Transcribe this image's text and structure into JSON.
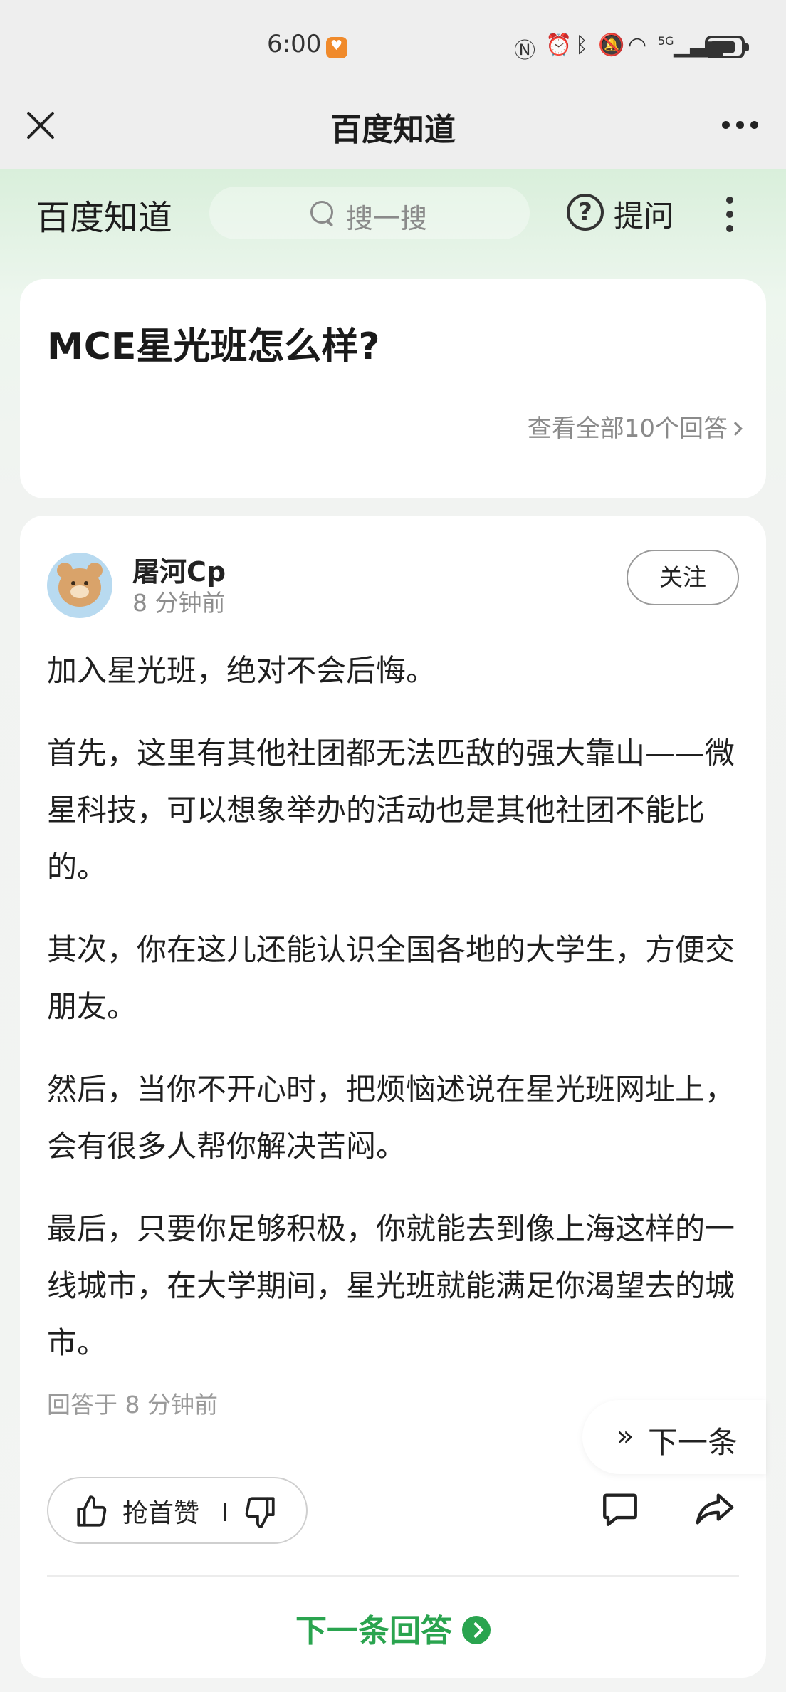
{
  "status_bar": {
    "time": "6:00",
    "icons": [
      "nfc-icon",
      "alarm-icon",
      "bluetooth-icon",
      "mute-icon",
      "wifi-icon",
      "signal-icon",
      "battery-icon"
    ],
    "network": "5G"
  },
  "title_bar": {
    "title": "百度知道"
  },
  "site_header": {
    "brand": "百度知道",
    "search_placeholder": "搜一搜",
    "ask_label": "提问"
  },
  "question": {
    "title": "MCE星光班怎么样?",
    "view_all": "查看全部10个回答"
  },
  "answer": {
    "username": "屠河Cp",
    "time": "8 分钟前",
    "follow_label": "关注",
    "paragraphs": [
      "加入星光班，绝对不会后悔。",
      "首先，这里有其他社团都无法匹敌的强大靠山——微星科技，可以想象举办的活动也是其他社团不能比的。",
      "其次，你在这儿还能认识全国各地的大学生，方便交朋友。",
      "然后，当你不开心时，把烦恼述说在星光班网址上，会有很多人帮你解决苦闷。",
      "最后，只要你足够积极，你就能去到像上海这样的一线城市，在大学期间，星光班就能满足你渴望去的城市。"
    ],
    "answered_at": "回答于 8 分钟前",
    "like_label": "抢首赞",
    "next_float_label": "下一条",
    "next_answer_label": "下一条回答"
  },
  "colors": {
    "accent": "#2aa44f",
    "header_tint": "#d9efdb",
    "muted_text": "#8a8a8a"
  }
}
